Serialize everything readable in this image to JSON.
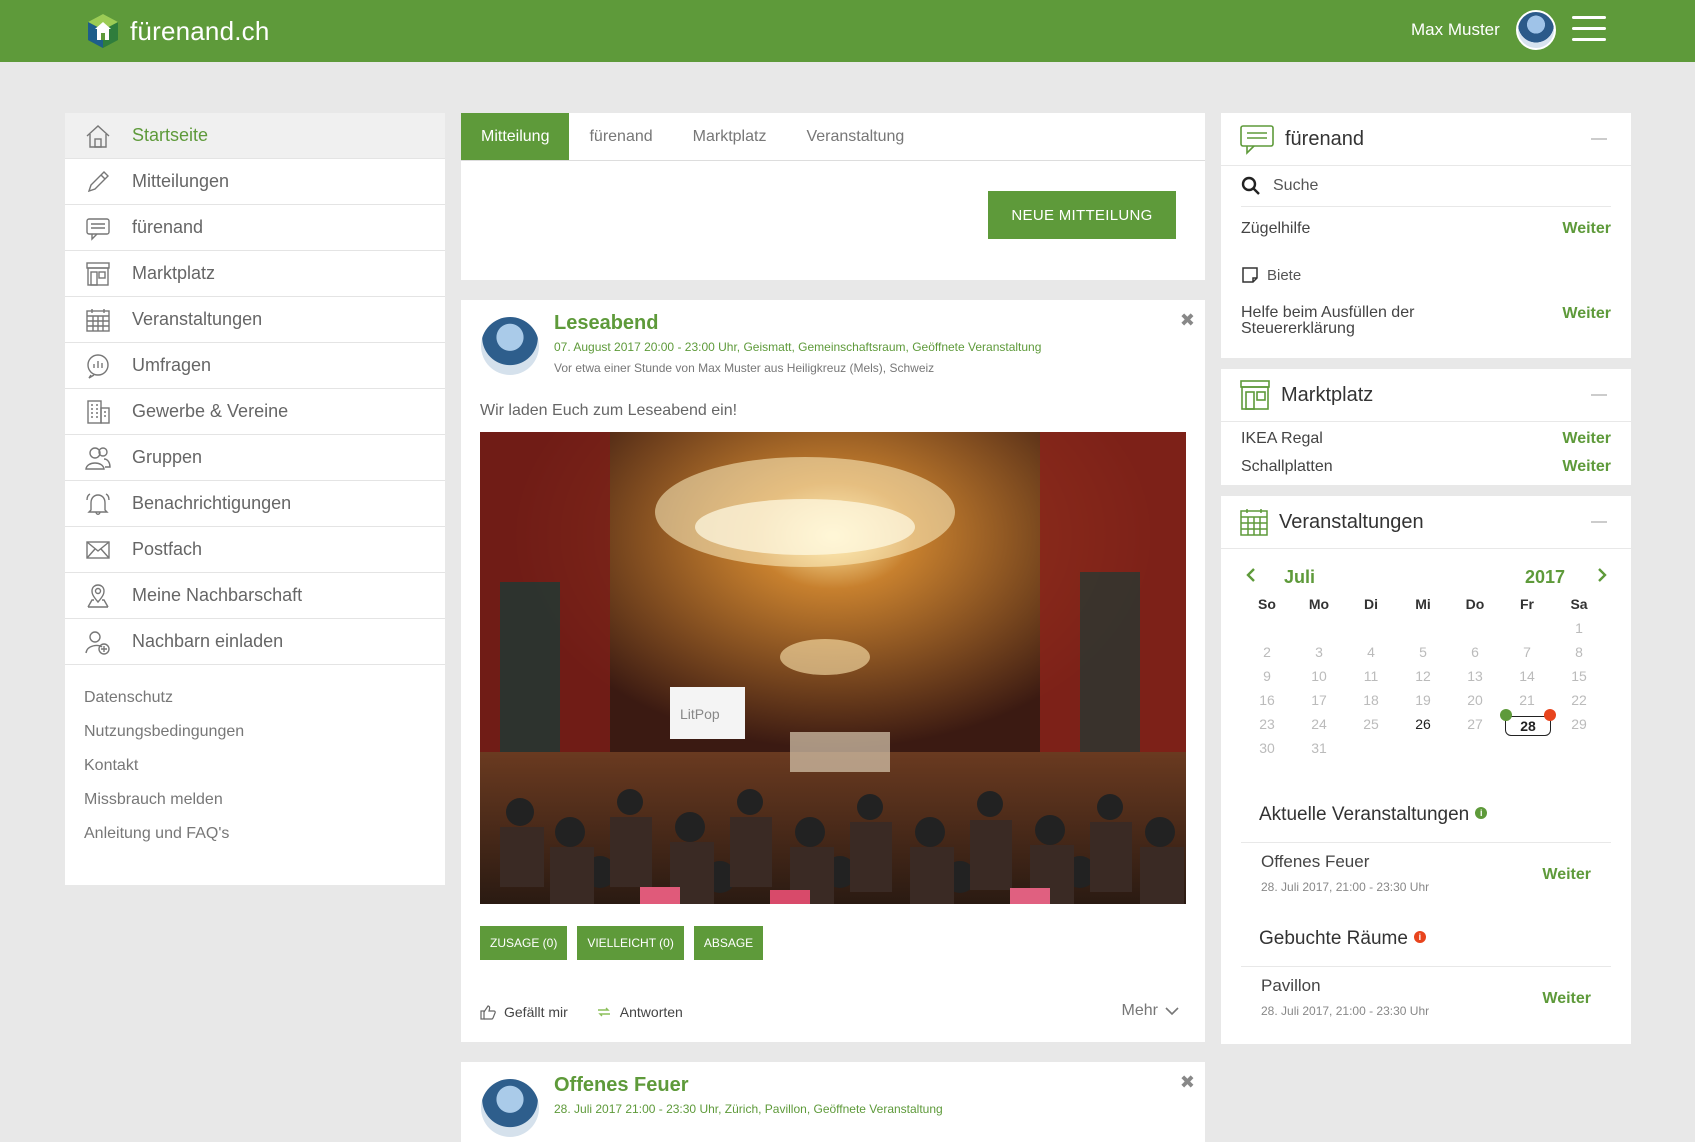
{
  "header": {
    "site_name": "fürenand.ch",
    "user_name": "Max Muster",
    "brand_color": "#5e9a3a"
  },
  "sidebar": {
    "items": [
      {
        "label": "Startseite",
        "icon": "home-icon"
      },
      {
        "label": "Mitteilungen",
        "icon": "pencil-icon"
      },
      {
        "label": "fürenand",
        "icon": "chat-icon"
      },
      {
        "label": "Marktplatz",
        "icon": "store-icon"
      },
      {
        "label": "Veranstaltungen",
        "icon": "calendar-icon"
      },
      {
        "label": "Umfragen",
        "icon": "poll-icon"
      },
      {
        "label": "Gewerbe & Vereine",
        "icon": "building-icon"
      },
      {
        "label": "Gruppen",
        "icon": "group-icon"
      },
      {
        "label": "Benachrichtigungen",
        "icon": "bell-icon"
      },
      {
        "label": "Postfach",
        "icon": "mail-icon"
      },
      {
        "label": "Meine Nachbarschaft",
        "icon": "location-icon"
      },
      {
        "label": "Nachbarn einladen",
        "icon": "add-user-icon"
      }
    ],
    "footer_links": [
      "Datenschutz",
      "Nutzungsbedingungen",
      "Kontakt",
      "Missbrauch melden",
      "Anleitung und FAQ's"
    ]
  },
  "main": {
    "tabs": [
      "Mitteilung",
      "fürenand",
      "Marktplatz",
      "Veranstaltung"
    ],
    "new_button": "NEUE MITTEILUNG",
    "post": {
      "title": "Leseabend",
      "meta": "07. August 2017 20:00 - 23:00 Uhr, Geismatt, Gemeinschaftsraum, Geöffnete Veranstaltung",
      "sub": "Vor etwa einer Stunde von Max Muster aus Heiligkreuz (Mels), Schweiz",
      "text": "Wir laden Euch zum Leseabend ein!",
      "image_sign": "LitPop",
      "buttons": [
        "ZUSAGE (0)",
        "VIELLEICHT (0)",
        "ABSAGE"
      ],
      "like": "Gefällt mir",
      "reply": "Antworten",
      "more": "Mehr"
    },
    "post2": {
      "title": "Offenes Feuer",
      "meta": "28. Juli 2017 21:00 - 23:30 Uhr, Zürich, Pavillon, Geöffnete Veranstaltung"
    }
  },
  "right": {
    "fuerenand": {
      "title": "fürenand",
      "search": "Suche",
      "item1": "Zügelhilfe",
      "offer_label": "Biete",
      "item2": "Helfe beim Ausfüllen der Steuererklärung",
      "weiter": "Weiter"
    },
    "marktplatz": {
      "title": "Marktplatz",
      "items": [
        "IKEA Regal",
        "Schallplatten"
      ],
      "weiter": "Weiter"
    },
    "veranstaltungen": {
      "title": "Veranstaltungen",
      "month": "Juli",
      "year": "2017",
      "weekdays": [
        "So",
        "Mo",
        "Di",
        "Mi",
        "Do",
        "Fr",
        "Sa"
      ],
      "days": [
        "1",
        "2",
        "3",
        "4",
        "5",
        "6",
        "7",
        "8",
        "9",
        "10",
        "11",
        "12",
        "13",
        "14",
        "15",
        "16",
        "17",
        "18",
        "19",
        "20",
        "21",
        "22",
        "23",
        "24",
        "25",
        "26",
        "27",
        "28",
        "29",
        "30",
        "31"
      ],
      "first_weekday_index": 6,
      "today": "26",
      "selected": "28",
      "current_title": "Aktuelle Veranstaltungen",
      "current_item": "Offenes Feuer",
      "current_time": "28. Juli 2017, 21:00 - 23:30 Uhr",
      "rooms_title": "Gebuchte Räume",
      "room_item": "Pavillon",
      "room_time": "28. Juli 2017, 21:00 - 23:30 Uhr",
      "weiter": "Weiter"
    }
  }
}
